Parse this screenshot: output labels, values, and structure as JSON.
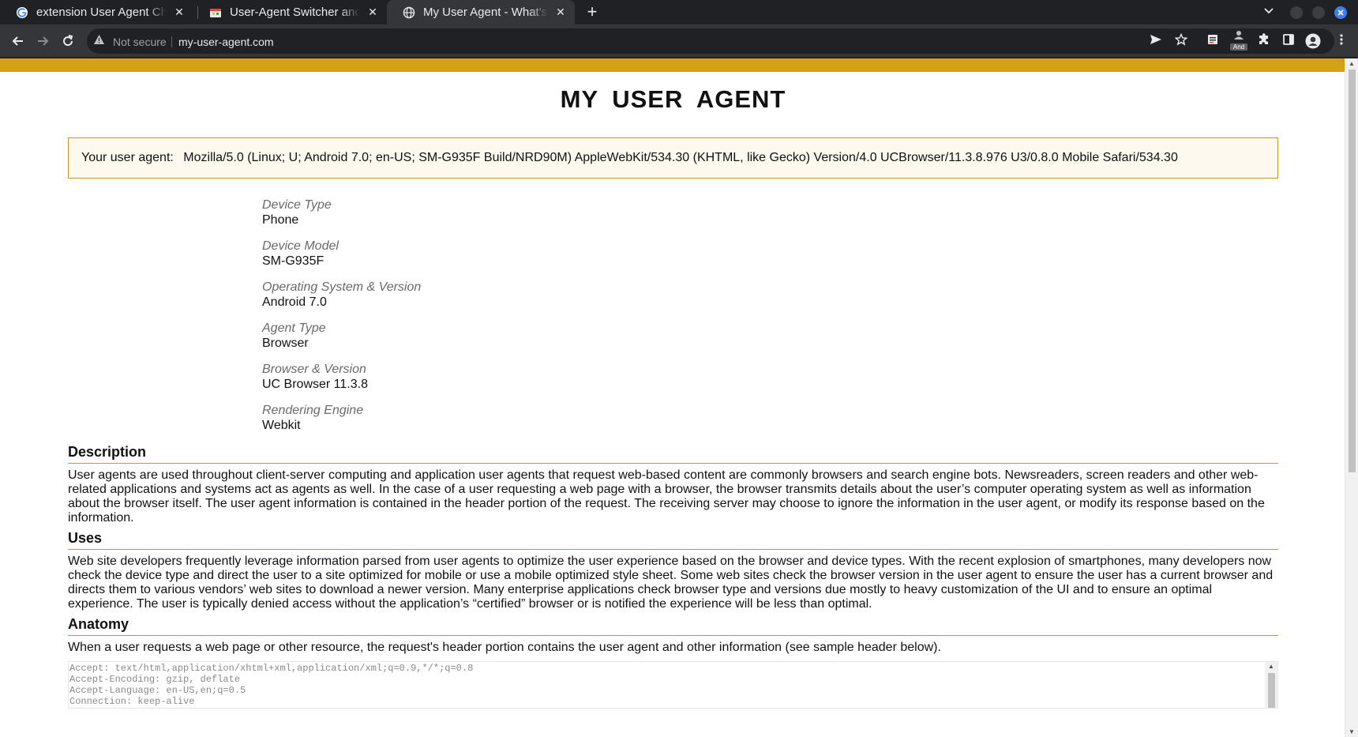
{
  "browser": {
    "tabs": [
      {
        "title": "extension User Agent Cha",
        "favicon": "google-icon"
      },
      {
        "title": "User-Agent Switcher and M",
        "favicon": "extension-store-icon"
      },
      {
        "title": "My User Agent - What's my",
        "favicon": "globe-icon",
        "active": true
      }
    ],
    "close_glyph": "✕",
    "new_tab_glyph": "+",
    "omnibox": {
      "security_label": "Not secure",
      "url": "my-user-agent.com"
    },
    "extension_badge": "And"
  },
  "page": {
    "title": "MY USER AGENT",
    "ua_label": "Your user agent:",
    "ua_value": "Mozilla/5.0 (Linux; U; Android 7.0; en-US; SM-G935F Build/NRD90M) AppleWebKit/534.30 (KHTML, like Gecko) Version/4.0 UCBrowser/11.3.8.976 U3/0.8.0 Mobile Safari/534.30",
    "details": [
      {
        "label": "Device Type",
        "value": "Phone"
      },
      {
        "label": "Device Model",
        "value": "SM-G935F"
      },
      {
        "label": "Operating System & Version",
        "value": "Android 7.0"
      },
      {
        "label": "Agent Type",
        "value": "Browser"
      },
      {
        "label": "Browser & Version",
        "value": "UC Browser 11.3.8"
      },
      {
        "label": "Rendering Engine",
        "value": "Webkit"
      }
    ],
    "sections": [
      {
        "heading": "Description",
        "text": "User agents are used throughout client-server computing and application user agents that request web-based content are commonly browsers and search engine bots. Newsreaders, screen readers and other web-related applications and systems act as agents as well. In the case of a user requesting a web page with a browser, the browser transmits details about the user’s computer operating system as well as information about the browser itself. The user agent information is contained in the header portion of the request. The receiving server may choose to ignore the information in the user agent, or modify its response based on the information."
      },
      {
        "heading": "Uses",
        "text": "Web site developers frequently leverage information parsed from user agents to optimize the user experience based on the browser and device types. With the recent explosion of smartphones, many developers now check the device type and direct the user to a site optimized for mobile or use a mobile optimized style sheet. Some web sites check the browser version in the user agent to ensure the user has a current browser and directs them to various vendors’ web sites to download a newer version. Many enterprise applications check browser type and versions due mostly to heavy customization of the UI and to ensure an optimal experience. The user is typically denied access without the application’s “certified” browser or is notified the experience will be less than optimal."
      },
      {
        "heading": "Anatomy",
        "text": "When a user requests a web page or other resource, the request's header portion contains the user agent and other information (see sample header below)."
      }
    ],
    "sample_header": "Accept: text/html,application/xhtml+xml,application/xml;q=0.9,*/*;q=0.8\nAccept-Encoding: gzip, deflate\nAccept-Language: en-US,en;q=0.5\nConnection: keep-alive"
  },
  "colors": {
    "accent": "#d4a017",
    "box_border": "#c8952c",
    "box_bg": "#fdf9ef"
  }
}
